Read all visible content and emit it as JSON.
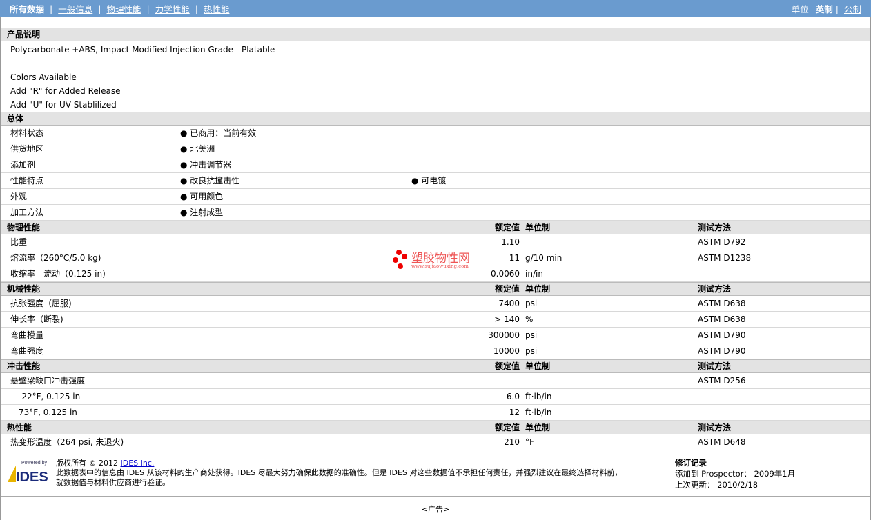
{
  "nav": {
    "items": [
      "所有数据",
      "一般信息",
      "物理性能",
      "力学性能",
      "热性能"
    ],
    "unit_label": "单位",
    "unit_english": "英制",
    "unit_metric": "公制"
  },
  "desc": {
    "title": "产品说明",
    "lines": [
      "Polycarbonate +ABS, Impact Modified Injection Grade - Platable",
      "",
      "Colors Available",
      "Add \"R\" for Added Release",
      "Add \"U\" for UV Stablilized"
    ]
  },
  "general": {
    "title": "总体",
    "rows": [
      {
        "label": "材料状态",
        "v1": "已商用：当前有效",
        "v2": ""
      },
      {
        "label": "供货地区",
        "v1": "北美洲",
        "v2": ""
      },
      {
        "label": "添加剂",
        "v1": "冲击调节器",
        "v2": ""
      },
      {
        "label": "性能特点",
        "v1": "改良抗撞击性",
        "v2": "可电镀"
      },
      {
        "label": "外观",
        "v1": "可用颜色",
        "v2": ""
      },
      {
        "label": "加工方法",
        "v1": "注射成型",
        "v2": ""
      }
    ]
  },
  "cols": {
    "value": "额定值",
    "unit": "单位制",
    "test": "测试方法"
  },
  "sections": [
    {
      "title": "物理性能",
      "rows": [
        {
          "label": "比重",
          "value": "1.10",
          "unit": "",
          "test": "ASTM D792"
        },
        {
          "label": "熔流率（260°C/5.0 kg)",
          "value": "11",
          "unit": "g/10 min",
          "test": "ASTM D1238"
        },
        {
          "label": "收缩率 - 流动（0.125 in)",
          "value": "0.0060",
          "unit": "in/in",
          "test": ""
        }
      ]
    },
    {
      "title": "机械性能",
      "rows": [
        {
          "label": "抗张强度（屈服)",
          "value": "7400",
          "unit": "psi",
          "test": "ASTM D638"
        },
        {
          "label": "伸长率（断裂)",
          "value": "> 140",
          "unit": "%",
          "test": "ASTM D638"
        },
        {
          "label": "弯曲模量",
          "value": "300000",
          "unit": "psi",
          "test": "ASTM D790"
        },
        {
          "label": "弯曲强度",
          "value": "10000",
          "unit": "psi",
          "test": "ASTM D790"
        }
      ]
    },
    {
      "title": "冲击性能",
      "rows": [
        {
          "label": "悬壁梁缺口冲击强度",
          "value": "",
          "unit": "",
          "test": "ASTM D256"
        },
        {
          "label": "-22°F, 0.125 in",
          "value": "6.0",
          "unit": "ft·lb/in",
          "test": "",
          "indent": true
        },
        {
          "label": "73°F, 0.125 in",
          "value": "12",
          "unit": "ft·lb/in",
          "test": "",
          "indent": true
        }
      ]
    },
    {
      "title": "热性能",
      "rows": [
        {
          "label": "热变形温度（264 psi, 未退火)",
          "value": "210",
          "unit": "°F",
          "test": "ASTM D648"
        }
      ]
    }
  ],
  "watermark": {
    "name": "塑胶物性网",
    "url": "www.sujiaowuxing.com"
  },
  "footer": {
    "logo_top": "Powered by",
    "logo": "IDES",
    "copyright": "版权所有 © 2012",
    "company": "IDES Inc.",
    "disclaimer1": "此数据表中的信息由 IDES 从该材料的生产商处获得。IDES 尽最大努力确保此数据的准确性。但是 IDES 对这些数据值不承担任何责任，并强烈建议在最终选择材料前，",
    "disclaimer2": "就数据值与材料供应商进行验证。",
    "rev_title": "修订记录",
    "added": "添加到 Prospector： 2009年1月",
    "updated": "上次更新： 2010/2/18",
    "ad": "<广告>"
  }
}
